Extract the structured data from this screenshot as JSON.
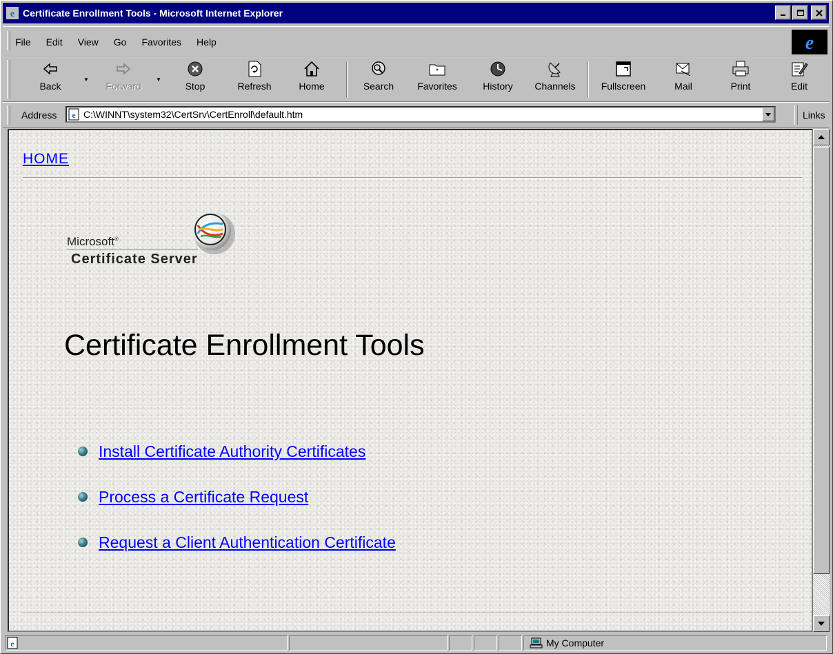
{
  "window": {
    "title": "Certificate Enrollment Tools - Microsoft Internet Explorer"
  },
  "menu": [
    {
      "label": "File"
    },
    {
      "label": "Edit"
    },
    {
      "label": "View"
    },
    {
      "label": "Go"
    },
    {
      "label": "Favorites"
    },
    {
      "label": "Help"
    }
  ],
  "toolbar": {
    "back": "Back",
    "forward": "Forward",
    "stop": "Stop",
    "refresh": "Refresh",
    "home": "Home",
    "search": "Search",
    "favorites": "Favorites",
    "history": "History",
    "channels": "Channels",
    "fullscreen": "Fullscreen",
    "mail": "Mail",
    "print": "Print",
    "edit": "Edit"
  },
  "address": {
    "label": "Address",
    "value": "C:\\WINNT\\system32\\CertSrv\\CertEnroll\\default.htm",
    "links_label": "Links"
  },
  "page": {
    "home_link": "HOME",
    "logo_microsoft": "Microsoft",
    "logo_reg": "®",
    "logo_product": "Certificate Server",
    "title": "Certificate Enrollment Tools",
    "links": [
      {
        "label": "Install Certificate Authority Certificates"
      },
      {
        "label": "Process a Certificate Request"
      },
      {
        "label": "Request a Client Authentication Certificate"
      }
    ]
  },
  "status": {
    "zone": "My Computer"
  }
}
